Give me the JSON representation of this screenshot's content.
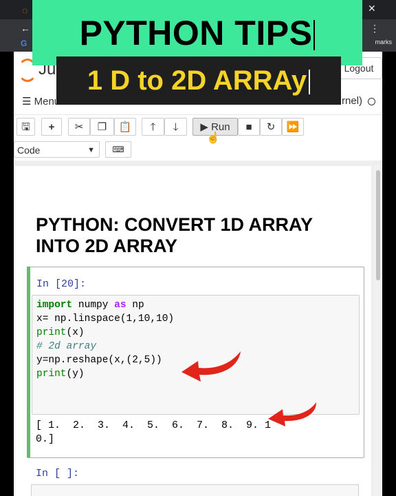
{
  "banner": {
    "title": "PYTHON TIPS",
    "subtitle": "1 D to 2D ARRAy"
  },
  "browser": {
    "bookmarks_label": "marks"
  },
  "jupyter": {
    "logo_text": "Ju",
    "logout_label": "Logout",
    "menu_label": "Menu",
    "kernel_label": "rnel)"
  },
  "toolbar": {
    "run_label": "Run",
    "cell_type": "Code"
  },
  "notebook": {
    "heading": "PYTHON: CONVERT 1D ARRAY INTO 2D ARRAY",
    "cell1": {
      "prompt": "In [20]:",
      "code": {
        "l1_kw": "import",
        "l1_mod": " numpy ",
        "l1_as": "as",
        "l1_alias": " np",
        "l2": "x= np.linspace(1,10,10)",
        "l3_fn": "print",
        "l3_rest": "(x)",
        "l4": "# 2d array",
        "l5": "y=np.reshape(x,(2,5))",
        "l6_fn": "print",
        "l6_rest": "(y)"
      },
      "output_line1": "[ 1.  2.  3.  4.  5.  6.  7.  8.  9. 1",
      "output_line2": "0.]"
    },
    "cell2": {
      "prompt": "In [ ]:"
    }
  },
  "colors": {
    "banner_green": "#3ee89a",
    "banner_dark": "#1f1f1f",
    "banner_yellow": "#f5d327",
    "arrow_red": "#e0261b",
    "cell_selected": "#66bb6a"
  }
}
